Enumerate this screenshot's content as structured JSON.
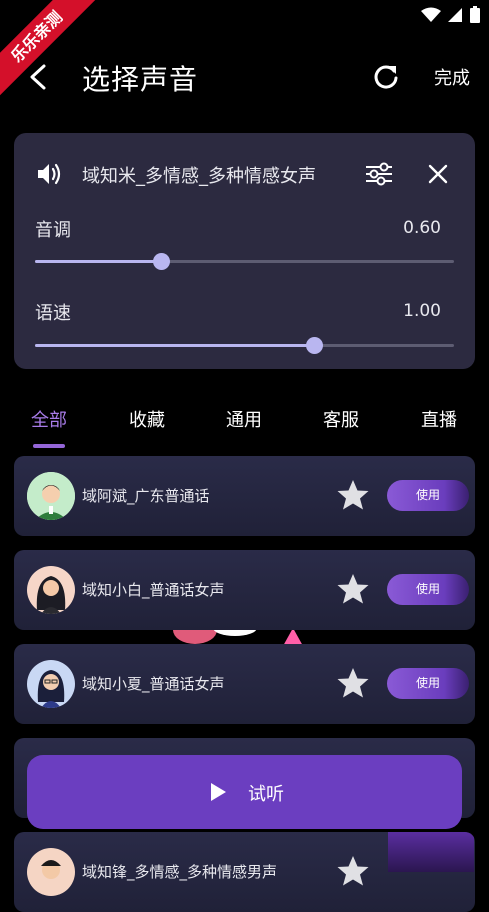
{
  "statusbar": {
    "badge": "乐乐亲测"
  },
  "header": {
    "title": "选择声音",
    "done_label": "完成"
  },
  "settings": {
    "voice_name": "域知米_多情感_多种情感女声",
    "pitch": {
      "label": "音调",
      "value_text": "0.60",
      "level": 0.3
    },
    "speed": {
      "label": "语速",
      "value_text": "1.00",
      "level": 0.665
    }
  },
  "tabs": [
    {
      "label": "全部",
      "active": true
    },
    {
      "label": "收藏"
    },
    {
      "label": "通用"
    },
    {
      "label": "客服"
    },
    {
      "label": "直播"
    }
  ],
  "voices": [
    {
      "name": "域阿斌_广东普通话",
      "use_label": "使用"
    },
    {
      "name": "域知小白_普通话女声",
      "use_label": "使用"
    },
    {
      "name": "域知小夏_普通话女声",
      "use_label": "使用"
    },
    {
      "name": "",
      "use_label": ""
    },
    {
      "name": "域知锋_多情感_多种情感男声",
      "use_label": ""
    }
  ],
  "listen": {
    "label": "试听"
  },
  "colors": {
    "accent": "#9466d8",
    "card": "#2c2a40",
    "slider": "#b9b6f0",
    "button": "#6b3ec0"
  }
}
